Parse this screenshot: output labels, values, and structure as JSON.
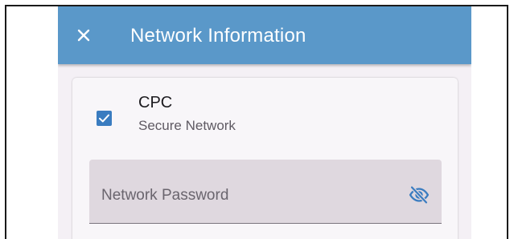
{
  "app_bar": {
    "title": "Network Information",
    "close_icon": "close-icon",
    "background_color": "#5a98c9"
  },
  "network": {
    "name": "CPC",
    "security_label": "Secure Network",
    "checked": true,
    "checkbox_color": "#3a7cc0"
  },
  "password_field": {
    "placeholder": "Network Password",
    "visibility_icon": "eye-off-icon",
    "icon_color": "#3a7cc0"
  }
}
